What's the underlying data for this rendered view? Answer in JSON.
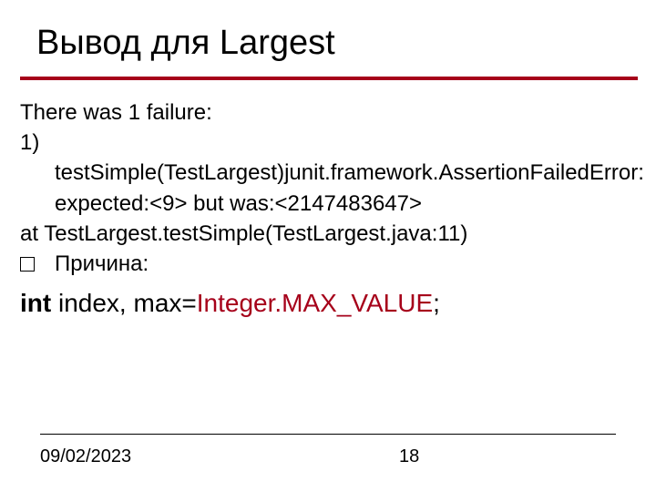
{
  "slide": {
    "title": "Вывод для Largest",
    "lines": {
      "failure_header": "There was 1 failure:",
      "item_number": "1)",
      "trace_main": "testSimple(TestLargest)junit.framework.AssertionFailedError:",
      "expected": "expected:<9> but was:<2147483647>",
      "at_line": "at TestLargest.testSimple(TestLargest.java:11)",
      "reason_label": "Причина:"
    },
    "code": {
      "kw": "int",
      "mid": " index, max=",
      "const": "Integer.MAX_VALUE",
      "semi": ";"
    },
    "footer": {
      "date": "09/02/2023",
      "page": "18"
    },
    "colors": {
      "accent": "#a6001a"
    }
  }
}
